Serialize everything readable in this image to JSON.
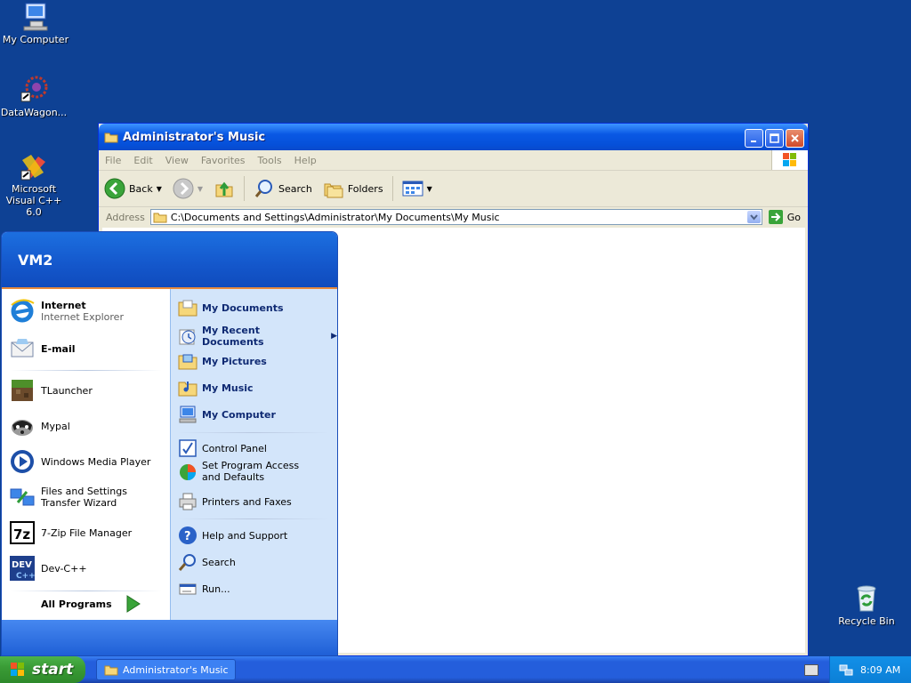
{
  "desktop": {
    "icons": [
      {
        "label": "My Computer",
        "icon": "my-computer-icon"
      },
      {
        "label": "DataWagon...",
        "icon": "datawagon-icon"
      },
      {
        "label": "Microsoft Visual C++ 6.0",
        "icon": "visual-cpp-icon"
      },
      {
        "label": "Recycle Bin",
        "icon": "recycle-bin-icon"
      }
    ]
  },
  "window": {
    "title": "Administrator's Music",
    "menu": [
      "File",
      "Edit",
      "View",
      "Favorites",
      "Tools",
      "Help"
    ],
    "toolbar": {
      "back": "Back",
      "search": "Search",
      "folders": "Folders"
    },
    "address_label": "Address",
    "address_value": "C:\\Documents and Settings\\Administrator\\My Documents\\My Music",
    "go": "Go"
  },
  "start_menu": {
    "user": "VM2",
    "pinned": [
      {
        "title": "Internet",
        "subtitle": "Internet Explorer",
        "icon": "internet-explorer-icon"
      },
      {
        "title": "E-mail",
        "icon": "email-icon"
      }
    ],
    "recent": [
      {
        "label": "TLauncher",
        "icon": "tlauncher-icon"
      },
      {
        "label": "Mypal",
        "icon": "mypal-icon"
      },
      {
        "label": "Windows Media Player",
        "icon": "media-player-icon"
      },
      {
        "label": "Files and Settings Transfer Wizard",
        "icon": "transfer-wizard-icon"
      },
      {
        "label": "7-Zip File Manager",
        "icon": "7zip-icon"
      },
      {
        "label": "Dev-C++",
        "icon": "dev-cpp-icon"
      }
    ],
    "all_programs": "All Programs",
    "places": [
      {
        "label": "My Documents",
        "icon": "folder-icon"
      },
      {
        "label": "My Recent Documents",
        "icon": "recent-documents-icon"
      },
      {
        "label": "My Pictures",
        "icon": "pictures-folder-icon"
      },
      {
        "label": "My Music",
        "icon": "music-folder-icon"
      },
      {
        "label": "My Computer",
        "icon": "my-computer-icon"
      }
    ],
    "settings": [
      {
        "label": "Control Panel",
        "icon": "control-panel-icon"
      },
      {
        "label": "Set Program Access and Defaults",
        "icon": "program-access-icon"
      },
      {
        "label": "Printers and Faxes",
        "icon": "printer-icon"
      }
    ],
    "help": [
      {
        "label": "Help and Support",
        "icon": "help-icon"
      },
      {
        "label": "Search",
        "icon": "search-icon"
      },
      {
        "label": "Run...",
        "icon": "run-icon"
      }
    ]
  },
  "taskbar": {
    "start": "start",
    "task": "Administrator's Music",
    "clock": "8:09 AM"
  }
}
